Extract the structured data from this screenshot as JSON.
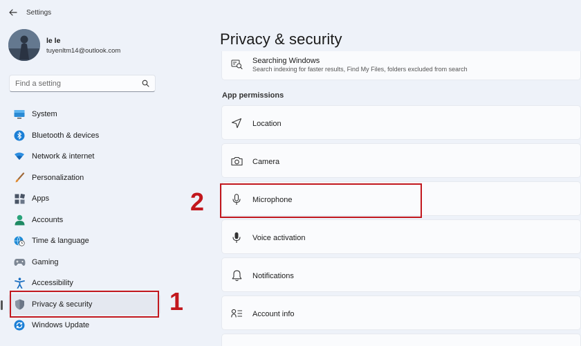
{
  "app": {
    "title": "Settings"
  },
  "user": {
    "name": "le le",
    "email": "tuyenltm14@outlook.com"
  },
  "search": {
    "placeholder": "Find a setting"
  },
  "nav": {
    "items": [
      {
        "label": "System",
        "icon": "system-icon"
      },
      {
        "label": "Bluetooth & devices",
        "icon": "bluetooth-icon"
      },
      {
        "label": "Network & internet",
        "icon": "wifi-icon"
      },
      {
        "label": "Personalization",
        "icon": "brush-icon"
      },
      {
        "label": "Apps",
        "icon": "apps-icon"
      },
      {
        "label": "Accounts",
        "icon": "person-icon"
      },
      {
        "label": "Time & language",
        "icon": "globe-clock-icon"
      },
      {
        "label": "Gaming",
        "icon": "gamepad-icon"
      },
      {
        "label": "Accessibility",
        "icon": "accessibility-icon"
      },
      {
        "label": "Privacy & security",
        "icon": "shield-icon",
        "selected": true
      },
      {
        "label": "Windows Update",
        "icon": "update-icon"
      }
    ]
  },
  "main": {
    "title": "Privacy & security",
    "top_item": {
      "title": "Searching Windows",
      "subtitle": "Search indexing for faster results, Find My Files, folders excluded from search",
      "icon": "search-windows-icon"
    },
    "section": "App permissions",
    "permissions": [
      {
        "label": "Location",
        "icon": "location-icon"
      },
      {
        "label": "Camera",
        "icon": "camera-icon"
      },
      {
        "label": "Microphone",
        "icon": "microphone-icon"
      },
      {
        "label": "Voice activation",
        "icon": "voice-activation-icon"
      },
      {
        "label": "Notifications",
        "icon": "bell-icon"
      },
      {
        "label": "Account info",
        "icon": "account-info-icon"
      }
    ]
  },
  "annotations": {
    "step1": "1",
    "step2": "2"
  },
  "colors": {
    "background": "#eef2f9",
    "card": "#fafbfd",
    "annotation_red": "#c2171d",
    "accent": "#0067c0"
  }
}
